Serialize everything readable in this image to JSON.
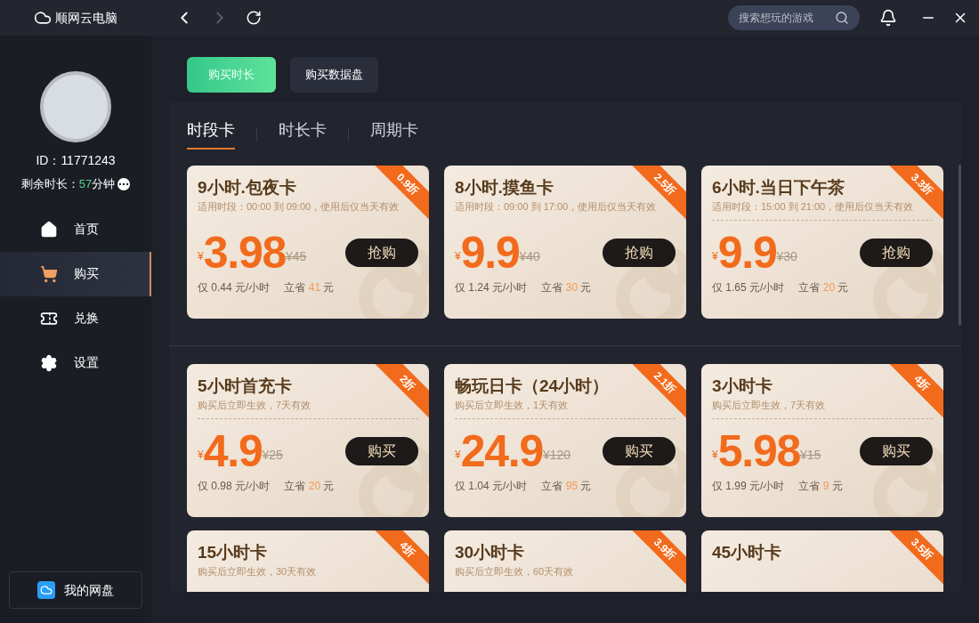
{
  "app": {
    "title": "顺网云电脑",
    "forward_disabled": true
  },
  "search": {
    "placeholder": "搜索想玩的游戏"
  },
  "user": {
    "id_label": "ID：",
    "id": "11771243",
    "remaining_label": "剩余时长：",
    "remaining_value": "57",
    "remaining_unit": "分钟"
  },
  "nav": [
    {
      "label": "首页",
      "kind": "home",
      "selected": false
    },
    {
      "label": "购买",
      "kind": "cart",
      "selected": true
    },
    {
      "label": "兑换",
      "kind": "ticket",
      "selected": false
    },
    {
      "label": "设置",
      "kind": "gear",
      "selected": false
    }
  ],
  "disk_button": "我的网盘",
  "top_tabs": [
    {
      "label": "购买时长",
      "selected": true
    },
    {
      "label": "购买数据盘",
      "selected": false
    }
  ],
  "card_tabs": [
    {
      "label": "时段卡",
      "selected": true
    },
    {
      "label": "时长卡",
      "selected": false
    },
    {
      "label": "周期卡",
      "selected": false
    }
  ],
  "sections": [
    {
      "cards": [
        {
          "title": "9小时.包夜卡",
          "subtitle": "适用时段：00:00 到 09:00，使用后仅当天有效",
          "divider": false,
          "discount": "0.9折",
          "currency": "¥",
          "price": "3.98",
          "original_price": "¥45",
          "button": "抢购",
          "per_hour": "仅 0.44 元/小时",
          "save_label": "立省",
          "save_amount": "41",
          "save_unit": "元"
        },
        {
          "title": "8小时.摸鱼卡",
          "subtitle": "适用时段：09:00 到 17:00，使用后仅当天有效",
          "divider": false,
          "discount": "2.5折",
          "currency": "¥",
          "price": "9.9",
          "original_price": "¥40",
          "button": "抢购",
          "per_hour": "仅 1.24 元/小时",
          "save_label": "立省",
          "save_amount": "30",
          "save_unit": "元"
        },
        {
          "title": "6小时.当日下午茶",
          "subtitle": "适用时段：15:00 到 21:00，使用后仅当天有效",
          "divider": true,
          "discount": "3.3折",
          "currency": "¥",
          "price": "9.9",
          "original_price": "¥30",
          "button": "抢购",
          "per_hour": "仅 1.65 元/小时",
          "save_label": "立省",
          "save_amount": "20",
          "save_unit": "元"
        }
      ]
    },
    {
      "cards": [
        {
          "title": "5小时首充卡",
          "subtitle": "购买后立即生效，7天有效",
          "divider": true,
          "discount": "2折",
          "currency": "¥",
          "price": "4.9",
          "original_price": "¥25",
          "button": "购买",
          "per_hour": "仅 0.98 元/小时",
          "save_label": "立省",
          "save_amount": "20",
          "save_unit": "元"
        },
        {
          "title": "畅玩日卡（24小时）",
          "subtitle": "购买后立即生效，1天有效",
          "divider": true,
          "discount": "2.1折",
          "currency": "¥",
          "price": "24.9",
          "original_price": "¥120",
          "button": "购买",
          "per_hour": "仅 1.04 元/小时",
          "save_label": "立省",
          "save_amount": "95",
          "save_unit": "元"
        },
        {
          "title": "3小时卡",
          "subtitle": "购买后立即生效，7天有效",
          "divider": true,
          "discount": "4折",
          "currency": "¥",
          "price": "5.98",
          "original_price": "¥15",
          "button": "购买",
          "per_hour": "仅 1.99 元/小时",
          "save_label": "立省",
          "save_amount": "9",
          "save_unit": "元"
        },
        {
          "title": "15小时卡",
          "subtitle": "购买后立即生效，30天有效",
          "discount": "4折"
        },
        {
          "title": "30小时卡",
          "subtitle": "购买后立即生效，60天有效",
          "discount": "3.9折"
        },
        {
          "title": "45小时卡",
          "discount": "3.5折"
        }
      ]
    }
  ]
}
